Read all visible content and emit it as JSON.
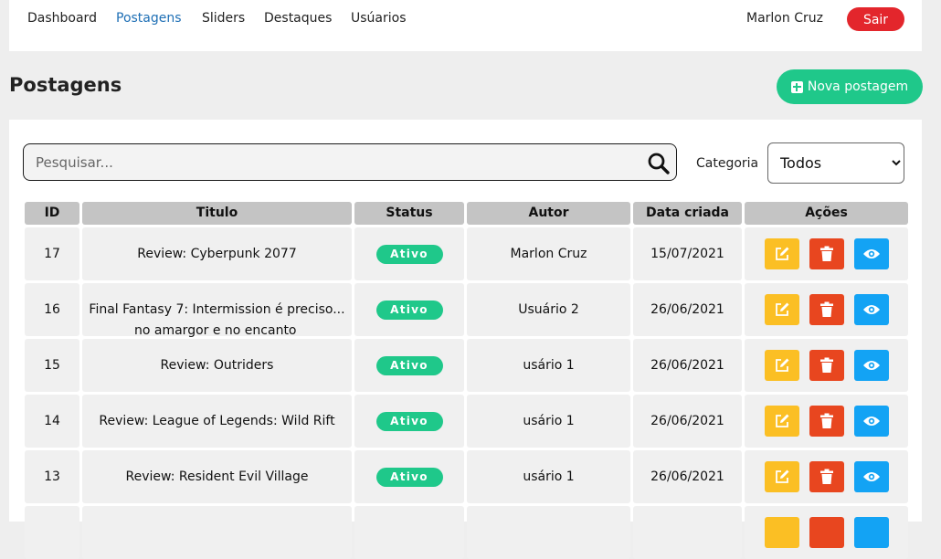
{
  "nav": {
    "items": [
      {
        "label": "Dashboard"
      },
      {
        "label": "Postagens"
      },
      {
        "label": "Sliders"
      },
      {
        "label": "Destaques"
      },
      {
        "label": "Usúarios"
      }
    ],
    "user_name": "Marlon Cruz",
    "logout_label": "Sair"
  },
  "page": {
    "title": "Postagens",
    "new_post_label": "Nova postagem"
  },
  "filters": {
    "search_placeholder": "Pesquisar...",
    "category_label": "Categoria",
    "category_selected": "Todos"
  },
  "table": {
    "columns": [
      "ID",
      "Titulo",
      "Status",
      "Autor",
      "Data criada",
      "Ações"
    ],
    "rows": [
      {
        "id": "17",
        "title": "Review: Cyberpunk 2077",
        "status": "Ativo",
        "author": "Marlon Cruz",
        "date": "15/07/2021"
      },
      {
        "id": "16",
        "title": "Final Fantasy 7: Intermission é preciso...",
        "title_overflow": "no amargor e no encanto",
        "status": "Ativo",
        "author": "Usuário 2",
        "date": "26/06/2021"
      },
      {
        "id": "15",
        "title": "Review: Outriders",
        "status": "Ativo",
        "author": "usário 1",
        "date": "26/06/2021"
      },
      {
        "id": "14",
        "title": "Review: League of Legends: Wild Rift",
        "status": "Ativo",
        "author": "usário 1",
        "date": "26/06/2021"
      },
      {
        "id": "13",
        "title": "Review: Resident Evil Village",
        "status": "Ativo",
        "author": "usário 1",
        "date": "26/06/2021"
      }
    ]
  },
  "icons": {
    "new": "plus-square-icon",
    "search": "search-icon",
    "edit": "edit-icon",
    "delete": "trash-icon",
    "view": "eye-icon"
  },
  "colors": {
    "logout": "#e3262c",
    "accent_green": "#1fc88a",
    "active_nav": "#1e6fb5",
    "edit": "#fbbf24",
    "delete": "#e8461f",
    "view": "#13a3f4"
  }
}
